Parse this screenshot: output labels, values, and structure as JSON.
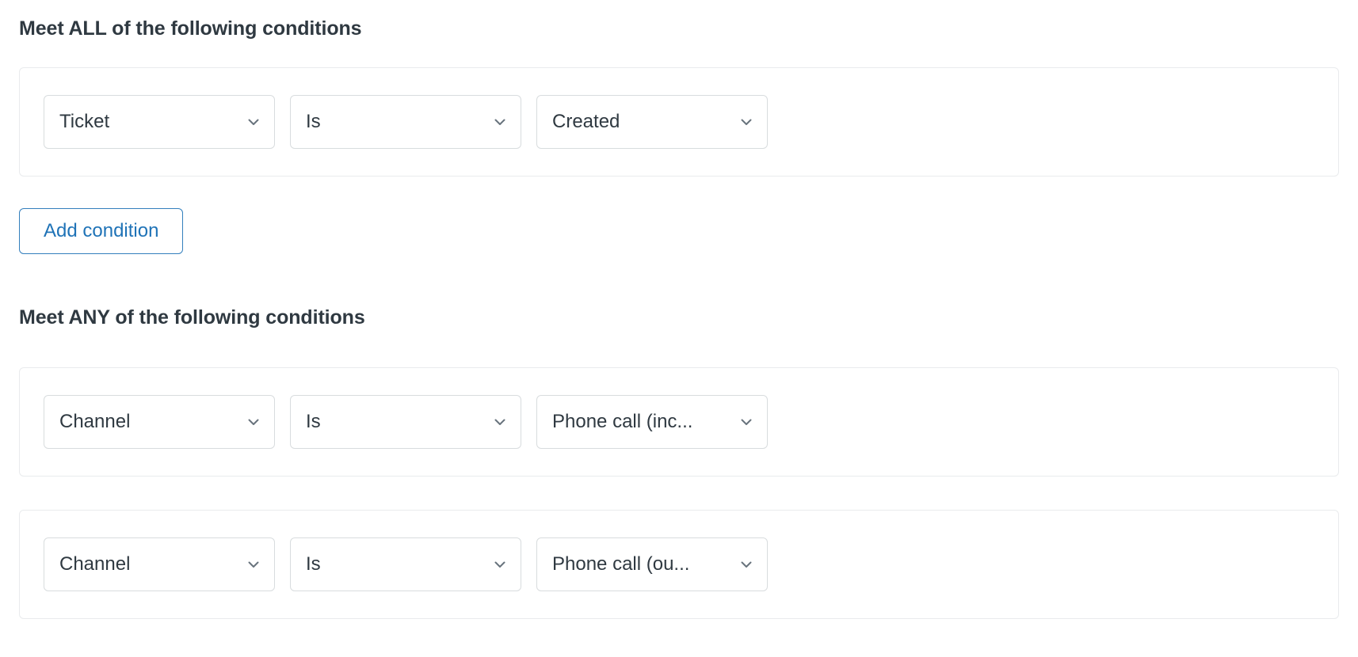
{
  "colors": {
    "text": "#2f3941",
    "card_border": "#e9ebed",
    "select_border": "#d8dcde",
    "accent_blue": "#1f73b7",
    "accent_blue_border": "#337fbd",
    "chevron": "#68737d",
    "background": "#ffffff"
  },
  "icons": {
    "chevron_down": "chevron-down-icon"
  },
  "sections": [
    {
      "heading": "Meet ALL of the following conditions",
      "conditions": [
        {
          "field": "Ticket",
          "operator": "Is",
          "value": "Created"
        }
      ],
      "add_button": "Add condition"
    },
    {
      "heading": "Meet ANY of the following conditions",
      "conditions": [
        {
          "field": "Channel",
          "operator": "Is",
          "value": "Phone call (inc..."
        },
        {
          "field": "Channel",
          "operator": "Is",
          "value": "Phone call (ou..."
        }
      ]
    }
  ]
}
